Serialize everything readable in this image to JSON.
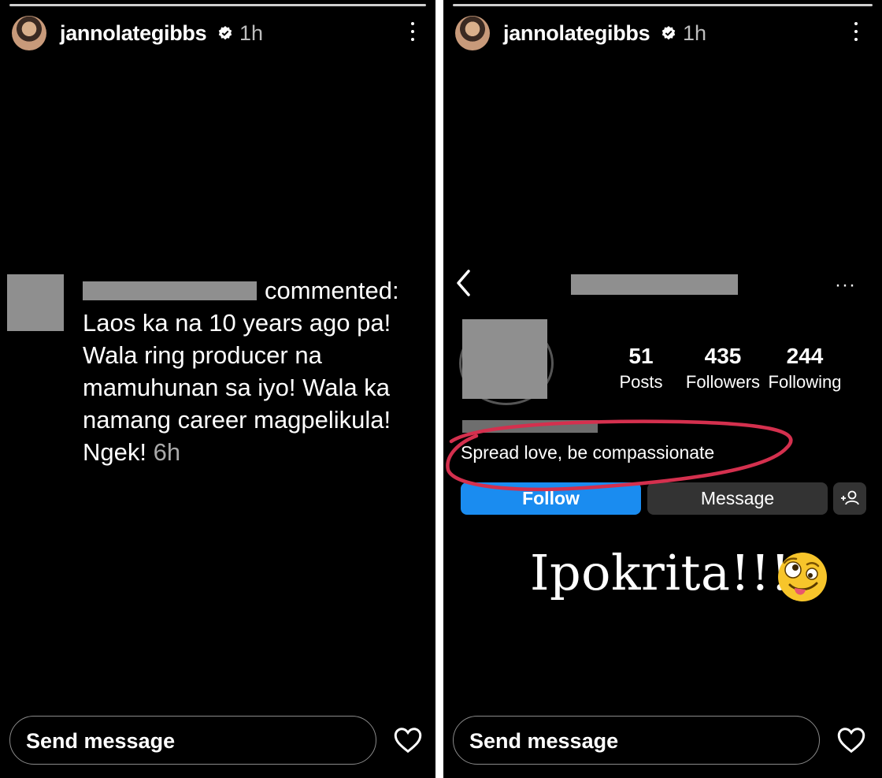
{
  "left": {
    "username": "jannolategibbs",
    "time": "1h",
    "comment": {
      "action": "commented:",
      "lines": [
        "Laos ka na 10 years ago pa!",
        "Wala ring producer na",
        "mamuhunan sa iyo! Wala ka",
        "namang career magpelikula!"
      ],
      "last": "Ngek!",
      "ago": "6h"
    },
    "send_placeholder": "Send message"
  },
  "right": {
    "username": "jannolategibbs",
    "time": "1h",
    "profile": {
      "more": "···",
      "stats": [
        {
          "number": "51",
          "label": "Posts"
        },
        {
          "number": "435",
          "label": "Followers"
        },
        {
          "number": "244",
          "label": "Following"
        }
      ],
      "bio": "Spread love, be compassionate",
      "follow_label": "Follow",
      "message_label": "Message"
    },
    "caption": "Ipokrita!!!",
    "send_placeholder": "Send message"
  },
  "colors": {
    "background": "#000000",
    "follow_button": "#1a8cf0",
    "message_button": "#333333",
    "annotation_circle": "#d4304e"
  },
  "icons": [
    "verified-badge-icon",
    "more-options-icon",
    "back-arrow-icon",
    "heart-icon",
    "add-user-icon",
    "zany-face-emoji"
  ]
}
